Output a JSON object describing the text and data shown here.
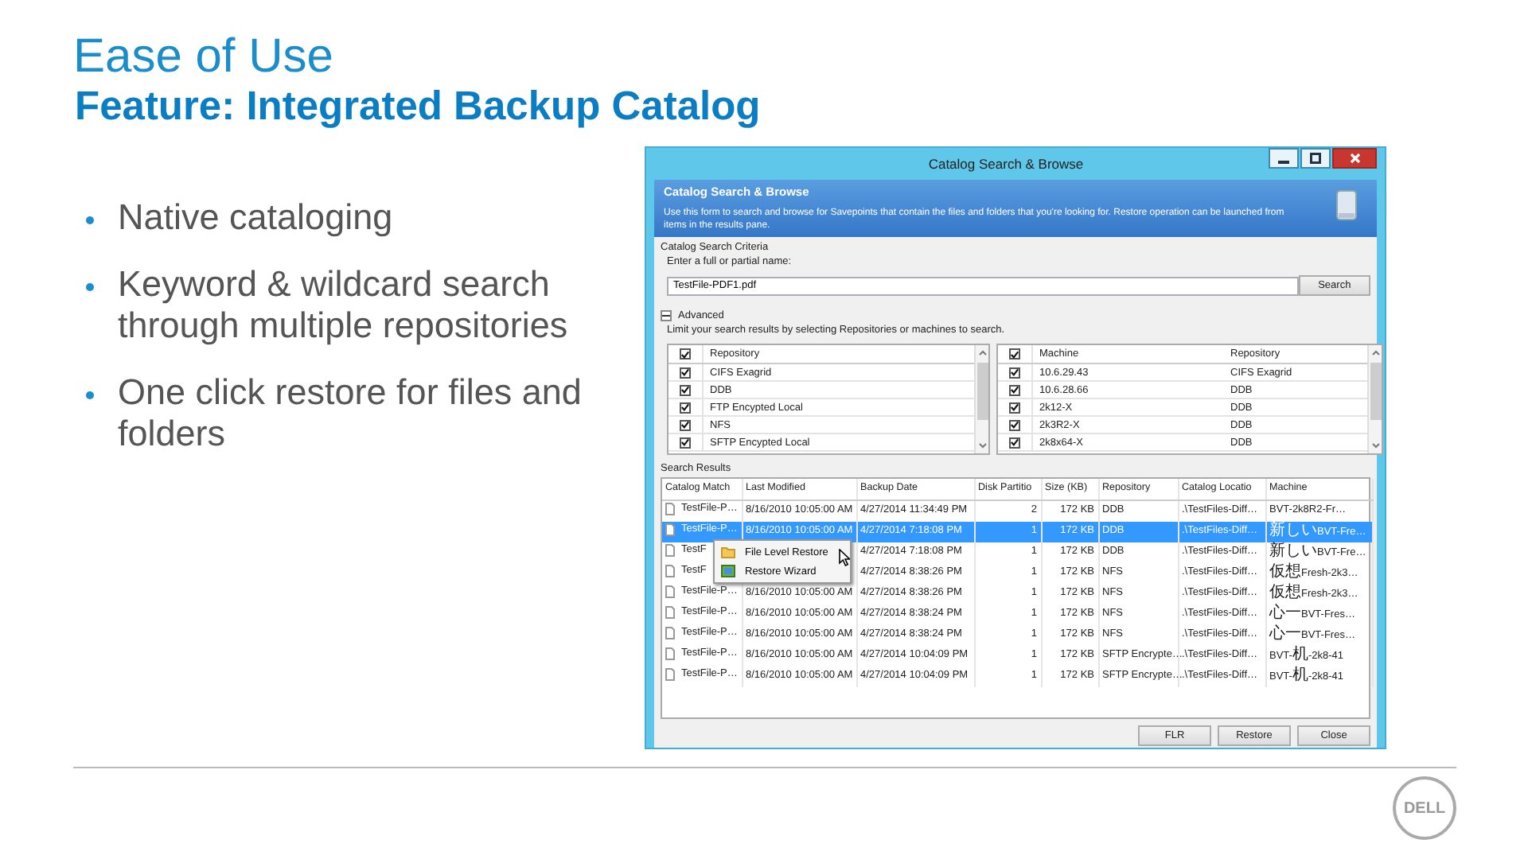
{
  "slide": {
    "title": "Ease of Use",
    "subtitle": "Feature: Integrated Backup Catalog",
    "bullets": [
      "Native cataloging",
      "Keyword & wildcard search through multiple repositories",
      "One click restore for files and folders"
    ],
    "logo": "DELL"
  },
  "window": {
    "title": "Catalog Search & Browse",
    "header": {
      "title": "Catalog Search & Browse",
      "description": "Use this form to search and browse for Savepoints that contain the files and folders that you're looking for. Restore operation can be launched from items in the results pane."
    },
    "criteria": {
      "group_label": "Catalog Search Criteria",
      "field_label": "Enter a full or partial name:",
      "value": "TestFile-PDF1.pdf",
      "button": "Search"
    },
    "advanced": {
      "label": "Advanced",
      "expanded": true,
      "hint": "Limit your search results by selecting Repositories or machines to search."
    },
    "repositories": {
      "all_checked": true,
      "columns": [
        "Repository"
      ],
      "rows": [
        {
          "name": "CIFS Exagrid",
          "checked": true
        },
        {
          "name": "DDB",
          "checked": true
        },
        {
          "name": "FTP Encypted Local",
          "checked": true
        },
        {
          "name": "NFS",
          "checked": true
        },
        {
          "name": "SFTP Encypted Local",
          "checked": true
        }
      ]
    },
    "machines": {
      "all_checked": true,
      "columns": [
        "Machine",
        "Repository"
      ],
      "rows": [
        {
          "machine": "10.6.29.43",
          "repository": "CIFS Exagrid",
          "checked": true
        },
        {
          "machine": "10.6.28.66",
          "repository": "DDB",
          "checked": true
        },
        {
          "machine": "2k12-X",
          "repository": "DDB",
          "checked": true
        },
        {
          "machine": "2k3R2-X",
          "repository": "DDB",
          "checked": true
        },
        {
          "machine": "2k8x64-X",
          "repository": "DDB",
          "checked": true
        }
      ]
    },
    "results": {
      "label": "Search Results",
      "columns": [
        "Catalog Match",
        "Last Modified",
        "Backup Date",
        "Disk Partitio",
        "Size (KB)",
        "Repository",
        "Catalog Locatio",
        "Machine"
      ],
      "rows": [
        {
          "catalog_match": "TestFile-P…",
          "last_modified": "8/16/2010 10:05:00 AM",
          "backup_date": "4/27/2014 11:34:49 PM",
          "disk_partition": "2",
          "size": "172 KB",
          "repository": "DDB",
          "catalog_location": ".\\TestFiles-Diff…",
          "machine": "BVT-2k8R2-Fr…",
          "selected": false
        },
        {
          "catalog_match": "TestFile-P…",
          "last_modified": "8/16/2010 10:05:00 AM",
          "backup_date": "4/27/2014 7:18:08 PM",
          "disk_partition": "1",
          "size": "172 KB",
          "repository": "DDB",
          "catalog_location": ".\\TestFiles-Diff…",
          "machine": "新しいBVT-Fre…",
          "selected": true
        },
        {
          "catalog_match": "TestF",
          "backup_date": "4/27/2014 7:18:08 PM",
          "disk_partition": "1",
          "size": "172 KB",
          "repository": "DDB",
          "catalog_location": ".\\TestFiles-Diff…",
          "machine": "新しいBVT-Fre…",
          "selected": false
        },
        {
          "catalog_match": "TestF",
          "backup_date": "4/27/2014 8:38:26 PM",
          "disk_partition": "1",
          "size": "172 KB",
          "repository": "NFS",
          "catalog_location": ".\\TestFiles-Diff…",
          "machine": "仮想Fresh-2k3…",
          "selected": false
        },
        {
          "catalog_match": "TestFile-P…",
          "last_modified": "8/16/2010 10:05:00 AM",
          "backup_date": "4/27/2014 8:38:26 PM",
          "disk_partition": "1",
          "size": "172 KB",
          "repository": "NFS",
          "catalog_location": ".\\TestFiles-Diff…",
          "machine": "仮想Fresh-2k3…",
          "selected": false
        },
        {
          "catalog_match": "TestFile-P…",
          "last_modified": "8/16/2010 10:05:00 AM",
          "backup_date": "4/27/2014 8:38:24 PM",
          "disk_partition": "1",
          "size": "172 KB",
          "repository": "NFS",
          "catalog_location": ".\\TestFiles-Diff…",
          "machine": "心一BVT-Fres…",
          "selected": false
        },
        {
          "catalog_match": "TestFile-P…",
          "last_modified": "8/16/2010 10:05:00 AM",
          "backup_date": "4/27/2014 8:38:24 PM",
          "disk_partition": "1",
          "size": "172 KB",
          "repository": "NFS",
          "catalog_location": ".\\TestFiles-Diff…",
          "machine": "心一BVT-Fres…",
          "selected": false
        },
        {
          "catalog_match": "TestFile-P…",
          "last_modified": "8/16/2010 10:05:00 AM",
          "backup_date": "4/27/2014 10:04:09 PM",
          "disk_partition": "1",
          "size": "172 KB",
          "repository": "SFTP Encrypte…",
          "catalog_location": ".\\TestFiles-Diff…",
          "machine": "BVT-机-2k8-41",
          "selected": false
        },
        {
          "catalog_match": "TestFile-P…",
          "last_modified": "8/16/2010 10:05:00 AM",
          "backup_date": "4/27/2014 10:04:09 PM",
          "disk_partition": "1",
          "size": "172 KB",
          "repository": "SFTP Encrypte…",
          "catalog_location": ".\\TestFiles-Diff…",
          "machine": "BVT-机-2k8-41",
          "selected": false
        }
      ]
    },
    "context_menu": [
      {
        "label": "File Level Restore",
        "kind": "folder"
      },
      {
        "label": "Restore Wizard",
        "kind": "wizard"
      }
    ],
    "buttons": [
      "FLR",
      "Restore",
      "Close"
    ]
  }
}
